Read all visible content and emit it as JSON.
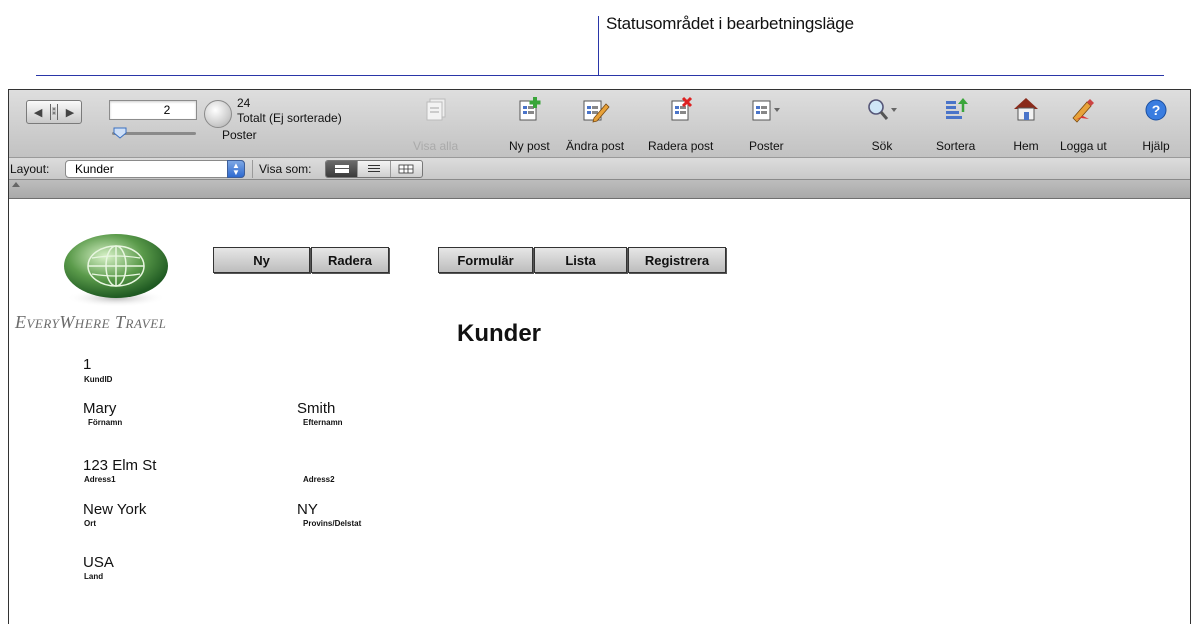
{
  "callout": {
    "label": "Statusområdet i bearbetningsläge"
  },
  "toolbar": {
    "record_number": "2",
    "total_count": "24",
    "total_label": "Totalt (Ej sorterade)",
    "records_label": "Poster",
    "buttons": [
      {
        "icon": "show-all-icon",
        "label": "Visa alla",
        "enabled": false
      },
      {
        "icon": "new-record-icon",
        "label": "Ny post",
        "enabled": true
      },
      {
        "icon": "edit-record-icon",
        "label": "Ändra post",
        "enabled": true
      },
      {
        "icon": "delete-record-icon",
        "label": "Radera post",
        "enabled": true
      },
      {
        "icon": "records-menu-icon",
        "label": "Poster",
        "enabled": true
      },
      {
        "icon": "search-icon",
        "label": "Sök",
        "enabled": true
      },
      {
        "icon": "sort-icon",
        "label": "Sortera",
        "enabled": true
      },
      {
        "icon": "home-icon",
        "label": "Hem",
        "enabled": true
      },
      {
        "icon": "logout-icon",
        "label": "Logga ut",
        "enabled": true
      },
      {
        "icon": "help-icon",
        "label": "Hjälp",
        "enabled": true
      }
    ]
  },
  "layoutbar": {
    "layout_label": "Layout:",
    "layout_value": "Kunder",
    "view_as_label": "Visa som:",
    "view_modes": [
      "form",
      "list",
      "table"
    ],
    "active_view": "form"
  },
  "content": {
    "brand": "EveryWhere Travel",
    "buttons": {
      "new": "Ny",
      "delete": "Radera",
      "form": "Formulär",
      "list": "Lista",
      "register": "Registrera"
    },
    "title": "Kunder",
    "fields": {
      "kundid": {
        "value": "1",
        "label": "KundID"
      },
      "fornamn": {
        "value": "Mary",
        "label": "Förnamn"
      },
      "efternamn": {
        "value": "Smith",
        "label": "Efternamn"
      },
      "adress1": {
        "value": "123 Elm St",
        "label": "Adress1"
      },
      "adress2": {
        "value": "",
        "label": "Adress2"
      },
      "ort": {
        "value": "New York",
        "label": "Ort"
      },
      "provins": {
        "value": "NY",
        "label": "Provins/Delstat"
      },
      "land": {
        "value": "USA",
        "label": "Land"
      }
    }
  },
  "colors": {
    "callout_line": "#2a36a8",
    "accent": "#2f6ad0"
  }
}
